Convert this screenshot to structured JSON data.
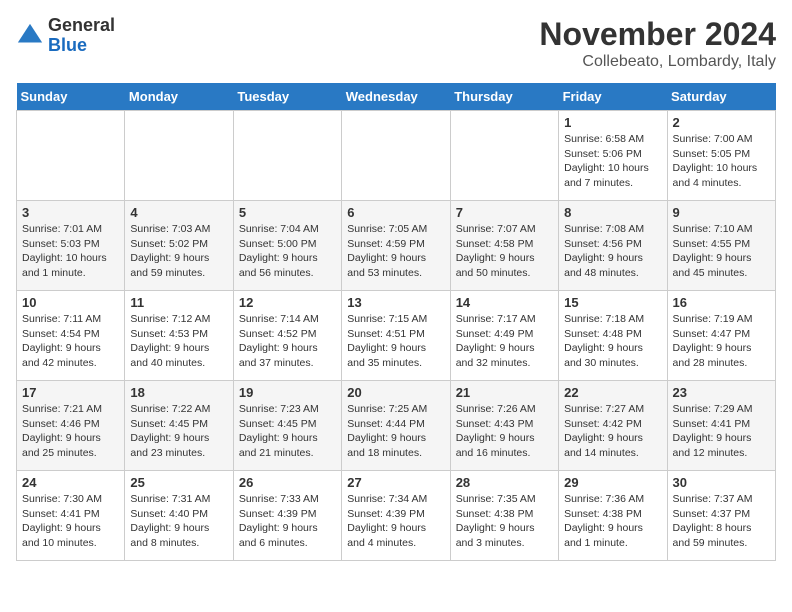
{
  "logo": {
    "general": "General",
    "blue": "Blue"
  },
  "title": "November 2024",
  "location": "Collebeato, Lombardy, Italy",
  "weekdays": [
    "Sunday",
    "Monday",
    "Tuesday",
    "Wednesday",
    "Thursday",
    "Friday",
    "Saturday"
  ],
  "weeks": [
    [
      {
        "day": "",
        "info": ""
      },
      {
        "day": "",
        "info": ""
      },
      {
        "day": "",
        "info": ""
      },
      {
        "day": "",
        "info": ""
      },
      {
        "day": "",
        "info": ""
      },
      {
        "day": "1",
        "info": "Sunrise: 6:58 AM\nSunset: 5:06 PM\nDaylight: 10 hours\nand 7 minutes."
      },
      {
        "day": "2",
        "info": "Sunrise: 7:00 AM\nSunset: 5:05 PM\nDaylight: 10 hours\nand 4 minutes."
      }
    ],
    [
      {
        "day": "3",
        "info": "Sunrise: 7:01 AM\nSunset: 5:03 PM\nDaylight: 10 hours\nand 1 minute."
      },
      {
        "day": "4",
        "info": "Sunrise: 7:03 AM\nSunset: 5:02 PM\nDaylight: 9 hours\nand 59 minutes."
      },
      {
        "day": "5",
        "info": "Sunrise: 7:04 AM\nSunset: 5:00 PM\nDaylight: 9 hours\nand 56 minutes."
      },
      {
        "day": "6",
        "info": "Sunrise: 7:05 AM\nSunset: 4:59 PM\nDaylight: 9 hours\nand 53 minutes."
      },
      {
        "day": "7",
        "info": "Sunrise: 7:07 AM\nSunset: 4:58 PM\nDaylight: 9 hours\nand 50 minutes."
      },
      {
        "day": "8",
        "info": "Sunrise: 7:08 AM\nSunset: 4:56 PM\nDaylight: 9 hours\nand 48 minutes."
      },
      {
        "day": "9",
        "info": "Sunrise: 7:10 AM\nSunset: 4:55 PM\nDaylight: 9 hours\nand 45 minutes."
      }
    ],
    [
      {
        "day": "10",
        "info": "Sunrise: 7:11 AM\nSunset: 4:54 PM\nDaylight: 9 hours\nand 42 minutes."
      },
      {
        "day": "11",
        "info": "Sunrise: 7:12 AM\nSunset: 4:53 PM\nDaylight: 9 hours\nand 40 minutes."
      },
      {
        "day": "12",
        "info": "Sunrise: 7:14 AM\nSunset: 4:52 PM\nDaylight: 9 hours\nand 37 minutes."
      },
      {
        "day": "13",
        "info": "Sunrise: 7:15 AM\nSunset: 4:51 PM\nDaylight: 9 hours\nand 35 minutes."
      },
      {
        "day": "14",
        "info": "Sunrise: 7:17 AM\nSunset: 4:49 PM\nDaylight: 9 hours\nand 32 minutes."
      },
      {
        "day": "15",
        "info": "Sunrise: 7:18 AM\nSunset: 4:48 PM\nDaylight: 9 hours\nand 30 minutes."
      },
      {
        "day": "16",
        "info": "Sunrise: 7:19 AM\nSunset: 4:47 PM\nDaylight: 9 hours\nand 28 minutes."
      }
    ],
    [
      {
        "day": "17",
        "info": "Sunrise: 7:21 AM\nSunset: 4:46 PM\nDaylight: 9 hours\nand 25 minutes."
      },
      {
        "day": "18",
        "info": "Sunrise: 7:22 AM\nSunset: 4:45 PM\nDaylight: 9 hours\nand 23 minutes."
      },
      {
        "day": "19",
        "info": "Sunrise: 7:23 AM\nSunset: 4:45 PM\nDaylight: 9 hours\nand 21 minutes."
      },
      {
        "day": "20",
        "info": "Sunrise: 7:25 AM\nSunset: 4:44 PM\nDaylight: 9 hours\nand 18 minutes."
      },
      {
        "day": "21",
        "info": "Sunrise: 7:26 AM\nSunset: 4:43 PM\nDaylight: 9 hours\nand 16 minutes."
      },
      {
        "day": "22",
        "info": "Sunrise: 7:27 AM\nSunset: 4:42 PM\nDaylight: 9 hours\nand 14 minutes."
      },
      {
        "day": "23",
        "info": "Sunrise: 7:29 AM\nSunset: 4:41 PM\nDaylight: 9 hours\nand 12 minutes."
      }
    ],
    [
      {
        "day": "24",
        "info": "Sunrise: 7:30 AM\nSunset: 4:41 PM\nDaylight: 9 hours\nand 10 minutes."
      },
      {
        "day": "25",
        "info": "Sunrise: 7:31 AM\nSunset: 4:40 PM\nDaylight: 9 hours\nand 8 minutes."
      },
      {
        "day": "26",
        "info": "Sunrise: 7:33 AM\nSunset: 4:39 PM\nDaylight: 9 hours\nand 6 minutes."
      },
      {
        "day": "27",
        "info": "Sunrise: 7:34 AM\nSunset: 4:39 PM\nDaylight: 9 hours\nand 4 minutes."
      },
      {
        "day": "28",
        "info": "Sunrise: 7:35 AM\nSunset: 4:38 PM\nDaylight: 9 hours\nand 3 minutes."
      },
      {
        "day": "29",
        "info": "Sunrise: 7:36 AM\nSunset: 4:38 PM\nDaylight: 9 hours\nand 1 minute."
      },
      {
        "day": "30",
        "info": "Sunrise: 7:37 AM\nSunset: 4:37 PM\nDaylight: 8 hours\nand 59 minutes."
      }
    ]
  ]
}
